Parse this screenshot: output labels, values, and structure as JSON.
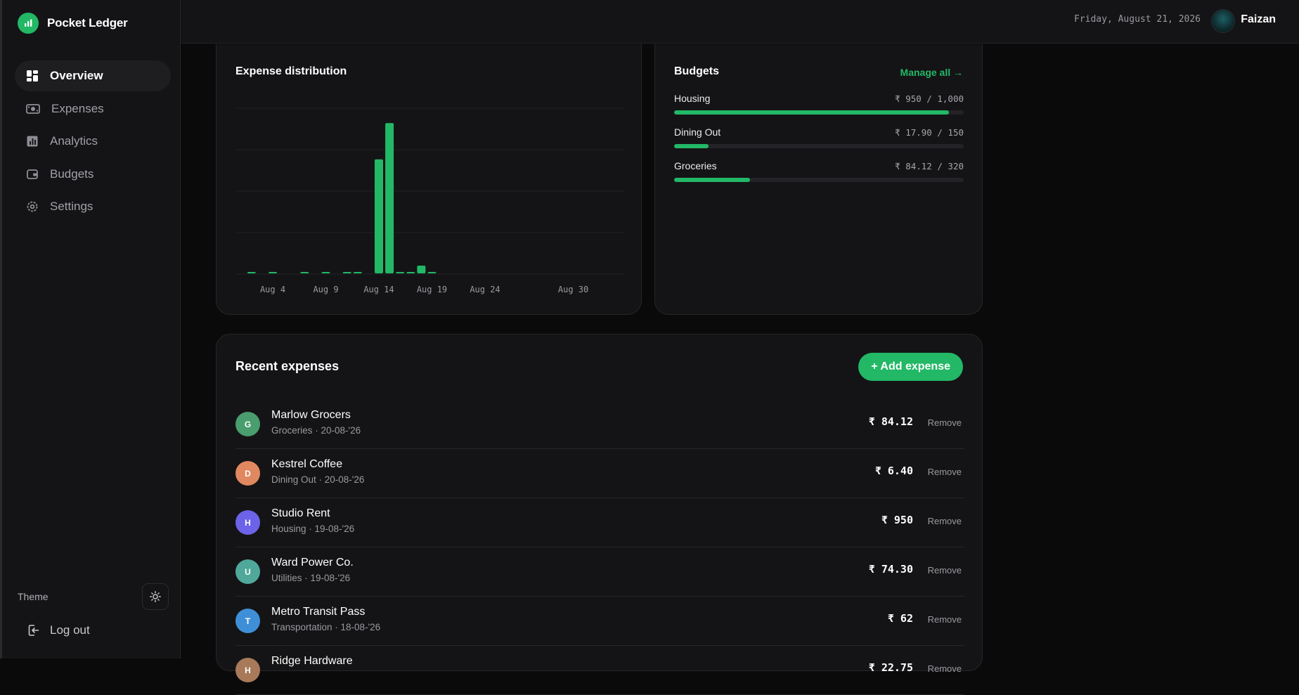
{
  "app": {
    "name": "Pocket Ledger"
  },
  "sidebar": {
    "items": [
      {
        "label": "Overview",
        "icon": "grid-icon",
        "active": true
      },
      {
        "label": "Expenses",
        "icon": "cash-icon"
      },
      {
        "label": "Analytics",
        "icon": "bar-chart-icon"
      },
      {
        "label": "Budgets",
        "icon": "wallet-icon"
      },
      {
        "label": "Settings",
        "icon": "gear-icon"
      }
    ],
    "theme_label": "Theme",
    "logout_label": "Log out"
  },
  "header": {
    "date": "Friday, August 21, 2026",
    "user_name": "Faizan"
  },
  "chart_card": {
    "title": "Expense distribution"
  },
  "chart_data": {
    "type": "bar",
    "title": "Expense distribution",
    "x_tick_labels": [
      "Aug 4",
      "Aug 9",
      "Aug 14",
      "Aug 19",
      "Aug 24",
      "Aug 30"
    ],
    "x": [
      "Aug 2",
      "Aug 4",
      "Aug 7",
      "Aug 9",
      "Aug 11",
      "Aug 12",
      "Aug 14",
      "Aug 15",
      "Aug 16",
      "Aug 17",
      "Aug 18",
      "Aug 19"
    ],
    "values": [
      1.5,
      2,
      4,
      1.5,
      1.5,
      6,
      1100,
      1450,
      1.5,
      6,
      74.3,
      8
    ],
    "ylim": [
      0,
      1600
    ],
    "grid": true,
    "color": "#22b866"
  },
  "budgets": {
    "title": "Budgets",
    "manage_label": "Manage all →",
    "items": [
      {
        "name": "Housing",
        "amount": "₹ 950 / 1,000",
        "fraction": 0.95
      },
      {
        "name": "Dining Out",
        "amount": "₹ 17.90 / 150",
        "fraction": 0.12
      },
      {
        "name": "Groceries",
        "amount": "₹ 84.12 / 320",
        "fraction": 0.263
      }
    ]
  },
  "expenses": {
    "title": "Recent expenses",
    "add_label": "+ Add expense",
    "remove_label": "Remove",
    "items": [
      {
        "initial": "G",
        "name": "Marlow Grocers",
        "meta": "Groceries · 20-08-'26",
        "amount": "₹ 84.12",
        "color": "#4a9d6e"
      },
      {
        "initial": "D",
        "name": "Kestrel Coffee",
        "meta": "Dining Out · 20-08-'26",
        "amount": "₹ 6.40",
        "color": "#e0885f"
      },
      {
        "initial": "H",
        "name": "Studio Rent",
        "meta": "Housing · 19-08-'26",
        "amount": "₹ 950",
        "color": "#6c63e8"
      },
      {
        "initial": "U",
        "name": "Ward Power Co.",
        "meta": "Utilities · 19-08-'26",
        "amount": "₹ 74.30",
        "color": "#4fa89a"
      },
      {
        "initial": "T",
        "name": "Metro Transit Pass",
        "meta": "Transportation · 18-08-'26",
        "amount": "₹ 62",
        "color": "#3f8fd8"
      },
      {
        "initial": "H",
        "name": "Ridge Hardware",
        "meta": "",
        "amount": "₹ 22.75",
        "color": "#a87a5a"
      }
    ]
  }
}
